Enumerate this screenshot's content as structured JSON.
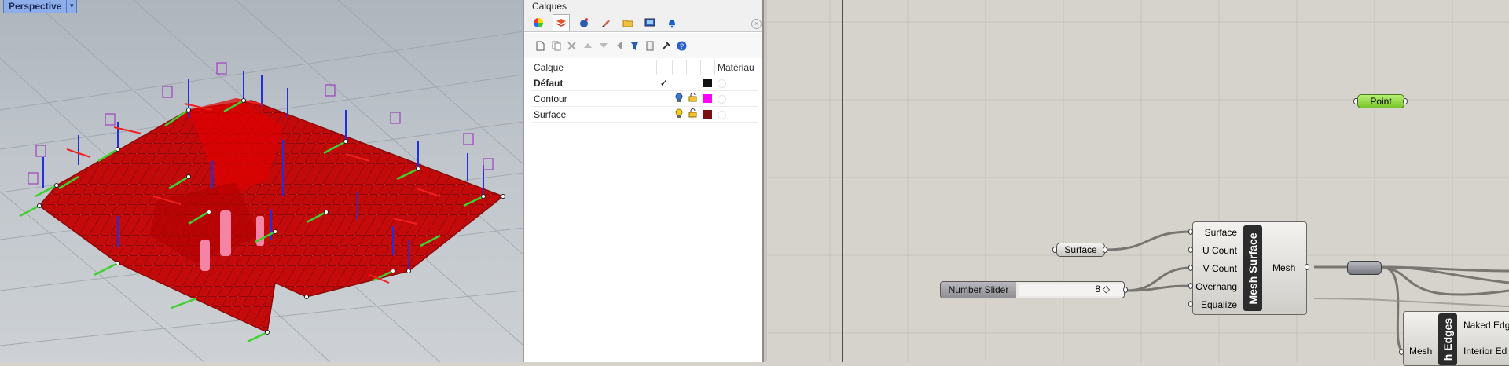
{
  "viewport": {
    "name": "Perspective",
    "menu_icon": "chevron-down-icon"
  },
  "layers_panel": {
    "title": "Calques",
    "tabs": [
      {
        "icon": "color-wheel-icon"
      },
      {
        "icon": "layers-icon",
        "active": true
      },
      {
        "icon": "render-icon"
      },
      {
        "icon": "brush-icon"
      },
      {
        "icon": "folder-icon"
      },
      {
        "icon": "display-icon"
      },
      {
        "icon": "bell-icon"
      }
    ],
    "toolbar_icons": [
      "new-layer-icon",
      "new-sublayer-icon",
      "delete-icon",
      "move-up-icon",
      "move-down-icon",
      "move-left-icon",
      "filter-icon",
      "copy-icon",
      "tools-icon",
      "help-icon"
    ],
    "columns": {
      "name": "Calque",
      "material": "Matériau"
    },
    "rows": [
      {
        "name": "Défaut",
        "current": true,
        "color": "#111111"
      },
      {
        "name": "Contour",
        "current": false,
        "bulb": "#3b78c8",
        "color": "#ff00ff"
      },
      {
        "name": "Surface",
        "current": false,
        "bulb": "#e6b800",
        "color": "#7a1010"
      }
    ],
    "checkmark": "✓"
  },
  "grasshopper": {
    "point_param": "Point",
    "surface_param": "Surface",
    "slider": {
      "label": "Number Slider",
      "value": "8",
      "knob": "◇"
    },
    "mesh_surface": {
      "name": "Mesh Surface",
      "inputs": [
        "Surface",
        "U Count",
        "V Count",
        "Overhang",
        "Equalize"
      ],
      "output": "Mesh"
    },
    "mesh_edges": {
      "name": "h Edges",
      "input": "Mesh",
      "outputs": [
        "Naked Edg",
        "Interior Ed"
      ]
    }
  }
}
